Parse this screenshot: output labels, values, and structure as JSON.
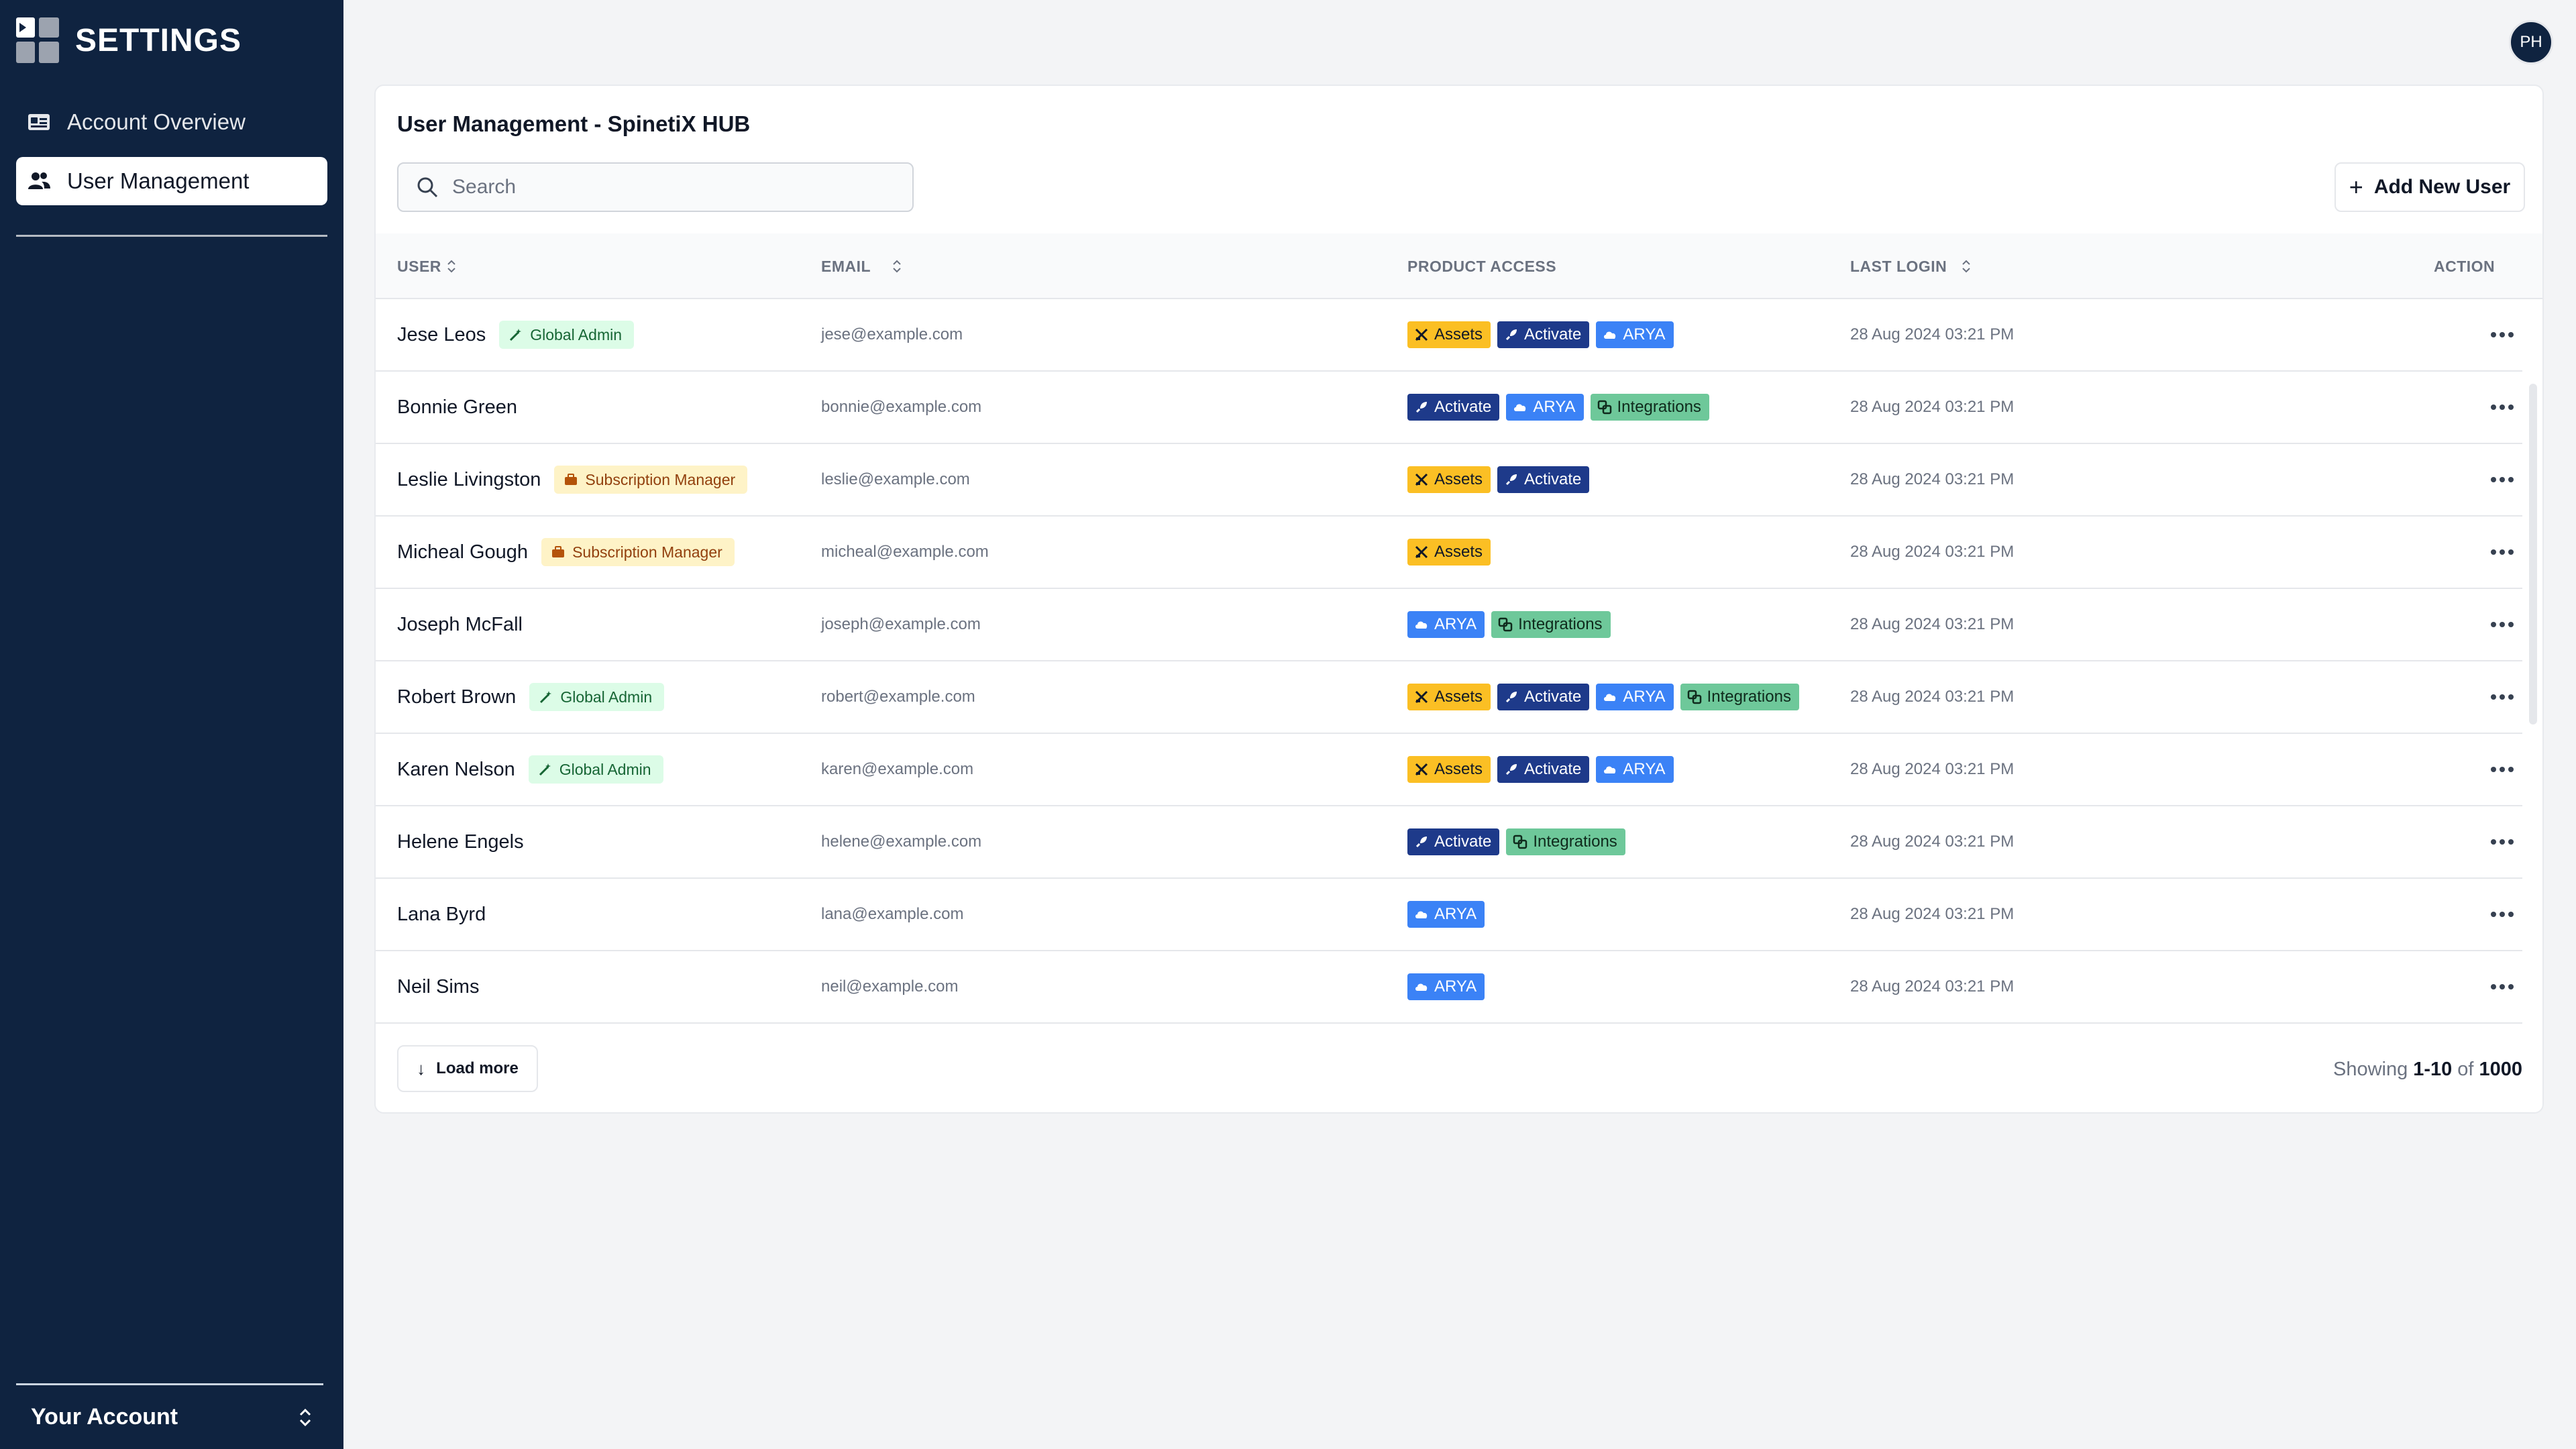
{
  "sidebar": {
    "title": "SETTINGS",
    "items": [
      {
        "label": "Account Overview",
        "icon": "id-card-icon",
        "active": false
      },
      {
        "label": "User Management",
        "icon": "users-icon",
        "active": true
      }
    ],
    "account_label": "Your Account"
  },
  "header": {
    "avatar_initials": "PH"
  },
  "main": {
    "title": "User Management - SpinetiX HUB",
    "search_placeholder": "Search",
    "add_button_label": "Add New User",
    "columns": {
      "user": "USER",
      "email": "EMAIL",
      "product_access": "PRODUCT ACCESS",
      "last_login": "LAST LOGIN",
      "action": "ACTION"
    },
    "rows": [
      {
        "name": "Jese Leos",
        "role": "Global Admin",
        "role_type": "admin",
        "email": "jese@example.com",
        "products": [
          "Assets",
          "Activate",
          "ARYA"
        ],
        "last_login": "28 Aug 2024 03:21 PM"
      },
      {
        "name": "Bonnie Green",
        "role": "",
        "role_type": "",
        "email": "bonnie@example.com",
        "products": [
          "Activate",
          "ARYA",
          "Integrations"
        ],
        "last_login": "28 Aug 2024 03:21 PM"
      },
      {
        "name": "Leslie Livingston",
        "role": "Subscription Manager",
        "role_type": "sub",
        "email": "leslie@example.com",
        "products": [
          "Assets",
          "Activate"
        ],
        "last_login": "28 Aug 2024 03:21 PM"
      },
      {
        "name": "Micheal Gough",
        "role": "Subscription Manager",
        "role_type": "sub",
        "email": "micheal@example.com",
        "products": [
          "Assets"
        ],
        "last_login": "28 Aug 2024 03:21 PM"
      },
      {
        "name": "Joseph McFall",
        "role": "",
        "role_type": "",
        "email": "joseph@example.com",
        "products": [
          "ARYA",
          "Integrations"
        ],
        "last_login": "28 Aug 2024 03:21 PM"
      },
      {
        "name": "Robert Brown",
        "role": "Global Admin",
        "role_type": "admin",
        "email": "robert@example.com",
        "products": [
          "Assets",
          "Activate",
          "ARYA",
          "Integrations"
        ],
        "last_login": "28 Aug 2024 03:21 PM"
      },
      {
        "name": "Karen Nelson",
        "role": "Global Admin",
        "role_type": "admin",
        "email": "karen@example.com",
        "products": [
          "Assets",
          "Activate",
          "ARYA"
        ],
        "last_login": "28 Aug 2024 03:21 PM"
      },
      {
        "name": "Helene Engels",
        "role": "",
        "role_type": "",
        "email": "helene@example.com",
        "products": [
          "Activate",
          "Integrations"
        ],
        "last_login": "28 Aug 2024 03:21 PM"
      },
      {
        "name": "Lana Byrd",
        "role": "",
        "role_type": "",
        "email": "lana@example.com",
        "products": [
          "ARYA"
        ],
        "last_login": "28 Aug 2024 03:21 PM"
      },
      {
        "name": "Neil Sims",
        "role": "",
        "role_type": "",
        "email": "neil@example.com",
        "products": [
          "ARYA"
        ],
        "last_login": "28 Aug 2024 03:21 PM"
      }
    ],
    "footer": {
      "load_more_label": "Load more",
      "showing_prefix": "Showing",
      "showing_range": "1-10",
      "showing_of": "of",
      "showing_total": "1000"
    }
  },
  "colors": {
    "sidebar_bg": "#0f2340",
    "assets": "#fbbf24",
    "activate": "#1e3a8a",
    "arya": "#3b82f6",
    "integrations": "#6ec89a"
  }
}
